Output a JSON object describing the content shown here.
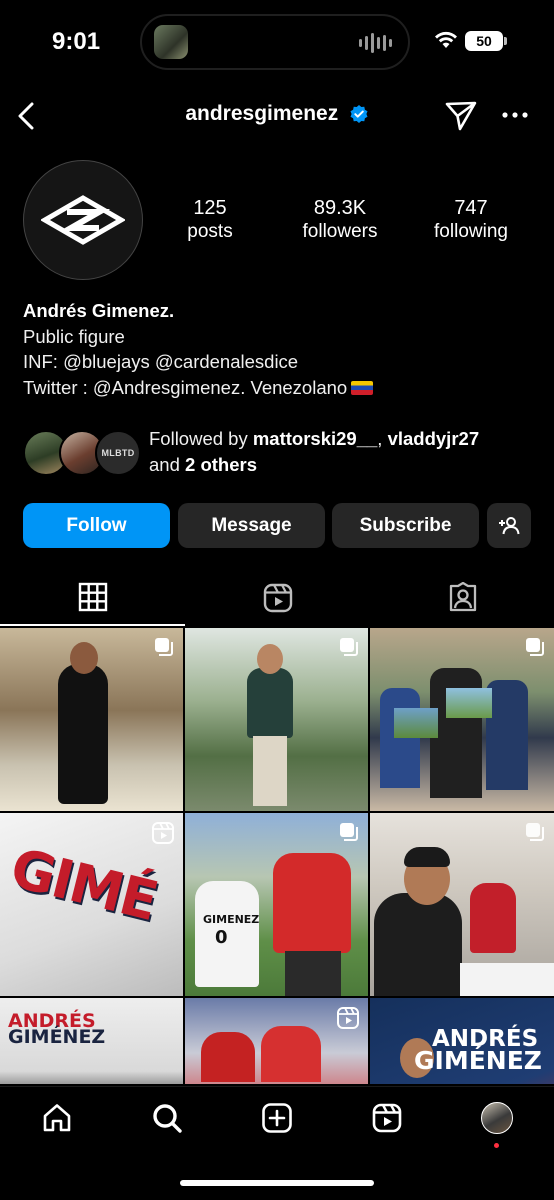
{
  "status_bar": {
    "time": "9:01",
    "battery": "50"
  },
  "header": {
    "username": "andresgimenez",
    "verified": true,
    "icons": [
      "back-icon",
      "verified-icon",
      "send-icon",
      "more-icon"
    ]
  },
  "profile": {
    "stats": [
      {
        "value": "125",
        "label": "posts"
      },
      {
        "value": "89.3K",
        "label": "followers"
      },
      {
        "value": "747",
        "label": "following"
      }
    ],
    "name": "Andrés Gimenez.",
    "category": "Public figure",
    "bio_line_1": "INF: @bluejays @cardenalesdice",
    "bio_line_2": "Twitter : @Andresgimenez.  Venezolano",
    "followed_by": {
      "prefix": "Followed by ",
      "user_1": "mattorski29__",
      "separator": ", ",
      "user_2": "vladdyjr27",
      "middle": "and ",
      "others": "2 others",
      "avatar_3_label": "MLBTD"
    }
  },
  "actions": {
    "follow": "Follow",
    "message": "Message",
    "subscribe": "Subscribe"
  },
  "tabs": [
    "grid-tab",
    "reels-tab",
    "tagged-tab"
  ],
  "posts": {
    "tile_4_text": "GIMÉ",
    "tile_5_text": "GIMENEZ",
    "tile_5_number": "0",
    "tile_7_line_1": "ANDRÉS",
    "tile_7_line_2": "GIMÉNEZ",
    "tile_9_line_1": "ANDRÉS",
    "tile_9_line_2": "GIMÉNEZ"
  },
  "bottom_nav": [
    "home-icon",
    "search-icon",
    "create-icon",
    "reels-icon",
    "profile-icon"
  ],
  "colors": {
    "background": "#000000",
    "follow_button": "#0095f6",
    "secondary_button": "#262626",
    "verified": "#0095f6",
    "notification_dot": "#ff3040"
  }
}
